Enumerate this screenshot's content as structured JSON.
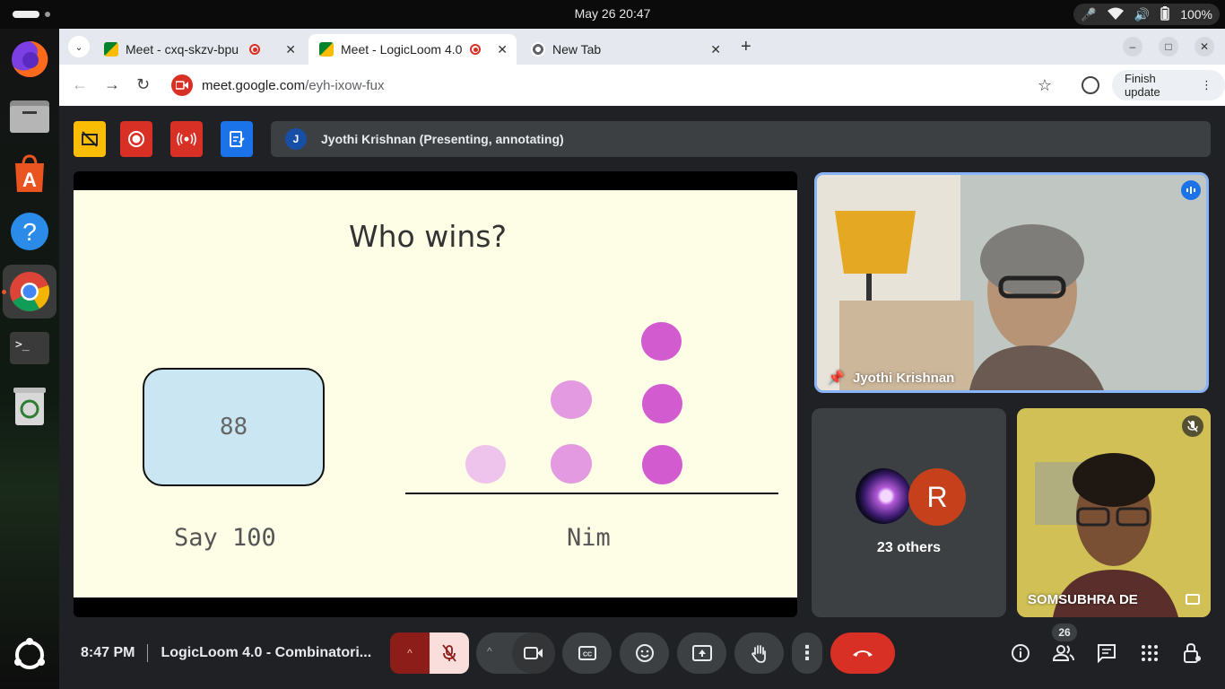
{
  "system": {
    "clock": "May 26  20:47",
    "battery": "100%"
  },
  "browser": {
    "tabs": [
      {
        "title": "Meet - cxq-skzv-bpu"
      },
      {
        "title": "Meet - LogicLoom 4.0"
      },
      {
        "title": "New Tab"
      }
    ],
    "url_host": "meet.google.com",
    "url_path": "/eyh-ixow-fux",
    "finish_update_label": "Finish update"
  },
  "meet": {
    "presenting_avatar_initial": "J",
    "presenting_text": "Jyothi Krishnan (Presenting, annotating)",
    "slide": {
      "title": "Who wins?",
      "box_value": "88",
      "left_label": "Say 100",
      "right_label": "Nim"
    },
    "tiles": {
      "presenter_name": "Jyothi Krishnan",
      "others_initial": "R",
      "others_label": "23 others",
      "participant_name": "SOMSUBHRA DE"
    },
    "bottom": {
      "time": "8:47 PM",
      "meeting_title": "LogicLoom 4.0 - Combinatori...",
      "people_count": "26"
    }
  },
  "colors": {
    "accent_red": "#d93025",
    "meet_bg": "#202124",
    "slide_bg": "#fefee6",
    "coin_light": "#efc4ec",
    "coin_mid": "#e39ae0",
    "coin_dark": "#d25bcf"
  }
}
